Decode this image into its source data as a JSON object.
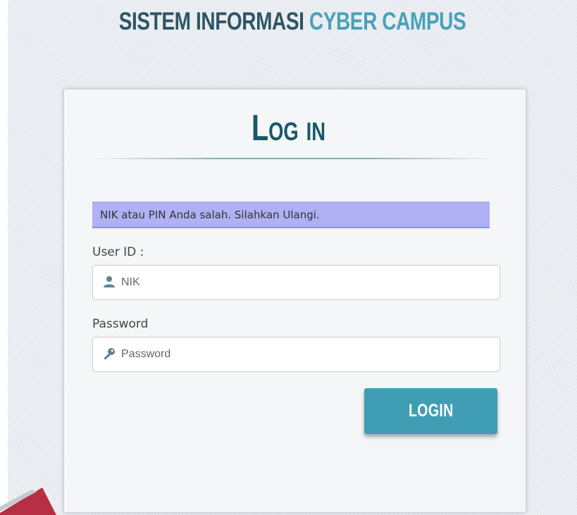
{
  "header": {
    "title_part1": "SISTEM INFORMASI",
    "title_part2": "CYBER CAMPUS"
  },
  "login_card": {
    "title": "Log in",
    "error_message": "NIK atau PIN Anda salah. Silahkan Ulangi.",
    "user_id": {
      "label": "User ID :",
      "placeholder": "NIK",
      "value": "",
      "icon": "user-icon"
    },
    "password": {
      "label": "Password",
      "placeholder": "Password",
      "value": "",
      "icon": "key-icon"
    },
    "submit_label": "LOGIN"
  },
  "colors": {
    "title_dark": "#2f5565",
    "title_accent": "#4aa1b8",
    "card_title": "#17586a",
    "alert_bg": "#b0b0f5",
    "button_bg": "#3f9db4",
    "watermark": "#b3243a"
  }
}
